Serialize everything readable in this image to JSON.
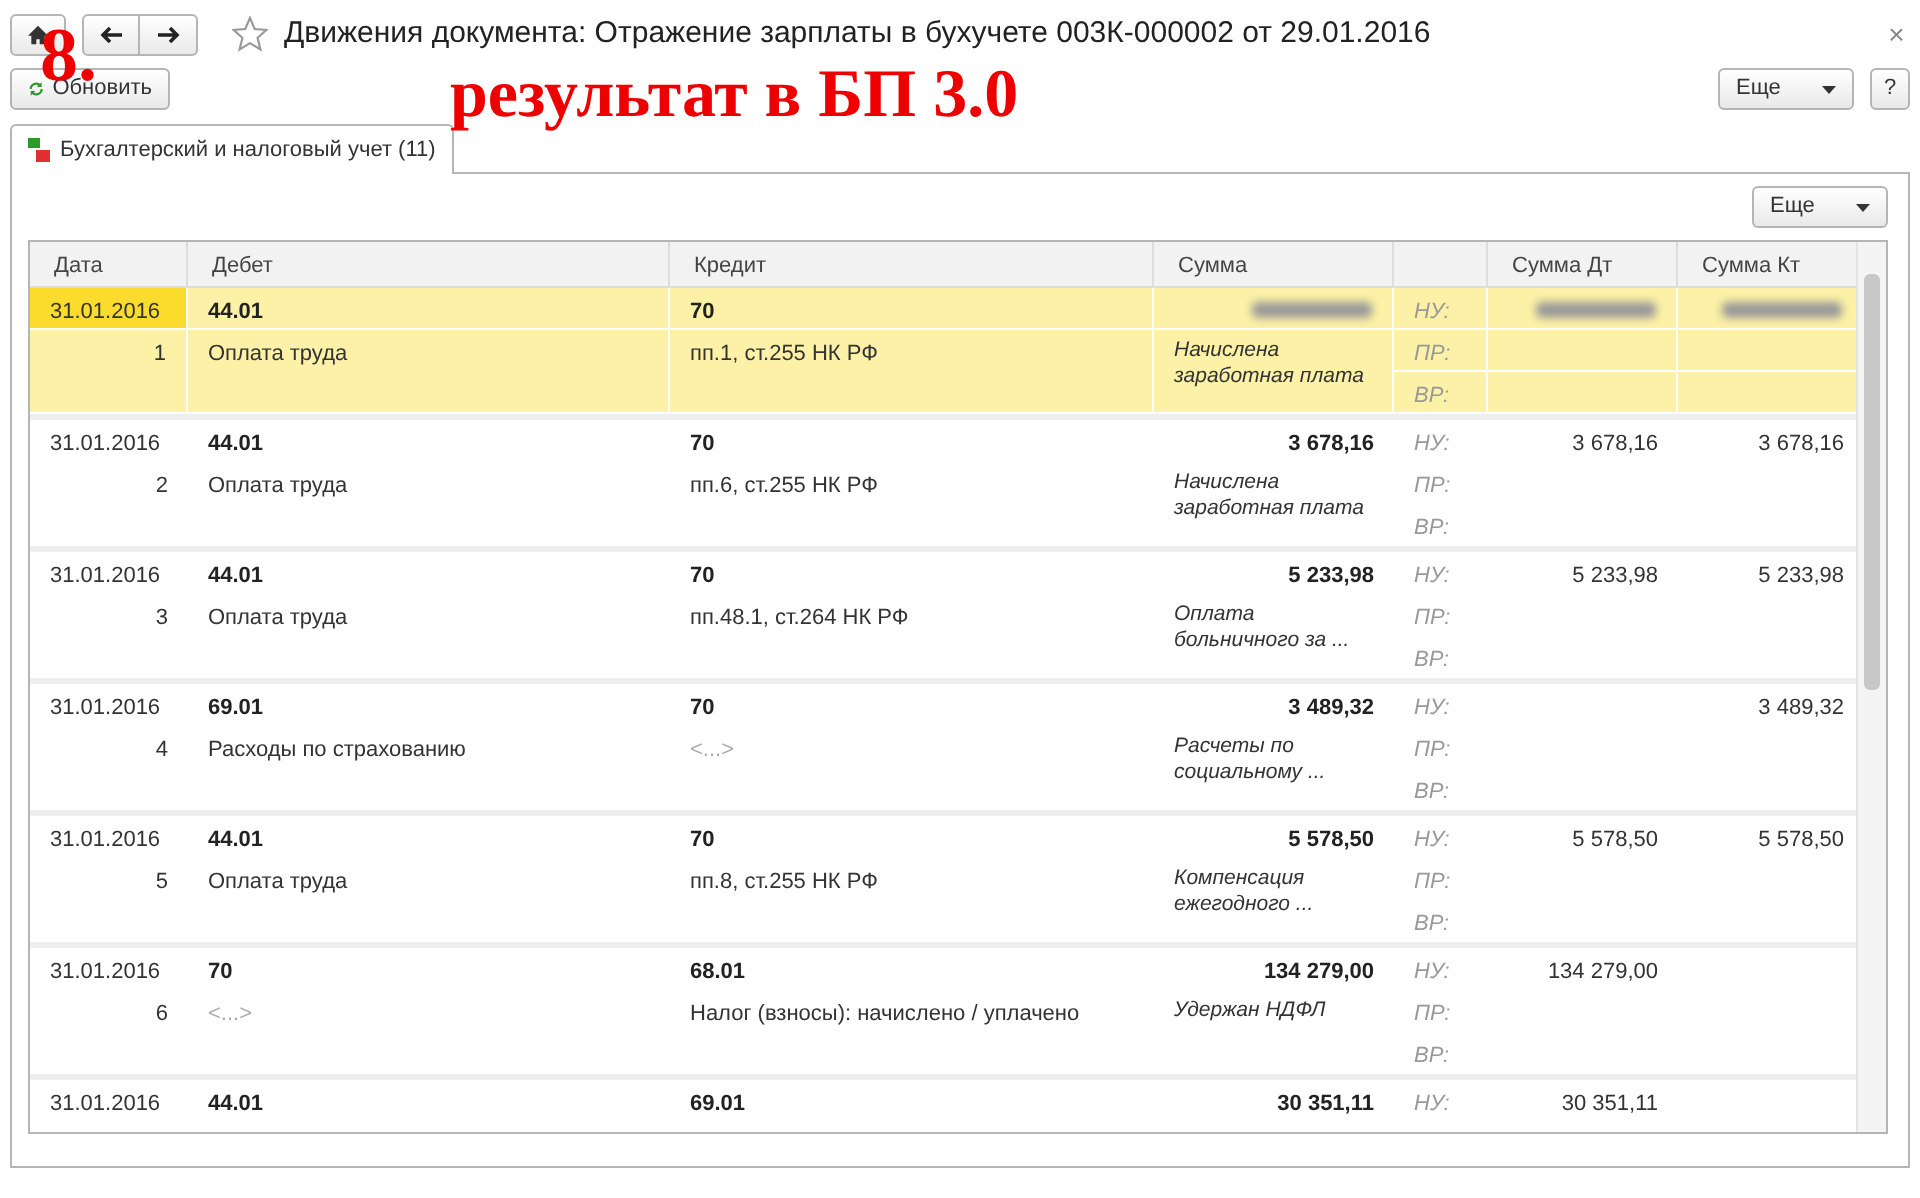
{
  "window": {
    "title": "Движения документа: Отражение зарплаты в бухучете 003К-000002 от 29.01.2016",
    "favorite": false,
    "close": "×"
  },
  "annotation": {
    "number": "8.",
    "text": "результат в БП 3.0"
  },
  "toolbar": {
    "refresh": "Обновить",
    "more": "Еще",
    "help": "?"
  },
  "tabs": [
    {
      "label": "Бухгалтерский и налоговый учет (11)",
      "selected": true
    }
  ],
  "table_toolbar": {
    "more": "Еще"
  },
  "table": {
    "columns": [
      "Дата",
      "Дебет",
      "Кредит",
      "Сумма",
      "Сумма Дт",
      "Сумма Кт"
    ],
    "records": [
      {
        "selected": true,
        "obscured": true,
        "date": "31.01.2016",
        "number": "1",
        "debit": "44.01",
        "debit_note": {
          "text": "Оплата труда",
          "empty": false
        },
        "credit": "70",
        "credit_note": {
          "text": "пп.1, ст.255 НК РФ",
          "empty": false
        },
        "content": "Начислена заработная плата",
        "labels": [
          "НУ:",
          "ПР:",
          "ВР:"
        ]
      },
      {
        "selected": false,
        "date": "31.01.2016",
        "number": "2",
        "debit": "44.01",
        "debit_note": {
          "text": "Оплата труда",
          "empty": false
        },
        "credit": "70",
        "credit_note": {
          "text": "пп.6, ст.255 НК РФ",
          "empty": false
        },
        "amount": "3 678,16",
        "content": "Начислена заработная плата",
        "labels": [
          "НУ:",
          "ПР:",
          "ВР:"
        ],
        "sum_dt": "3 678,16",
        "sum_kt": "3 678,16"
      },
      {
        "selected": false,
        "date": "31.01.2016",
        "number": "3",
        "debit": "44.01",
        "debit_note": {
          "text": "Оплата труда",
          "empty": false
        },
        "credit": "70",
        "credit_note": {
          "text": "пп.48.1, ст.264 НК РФ",
          "empty": false
        },
        "amount": "5 233,98",
        "content": "Оплата больничного за ...",
        "labels": [
          "НУ:",
          "ПР:",
          "ВР:"
        ],
        "sum_dt": "5 233,98",
        "sum_kt": "5 233,98"
      },
      {
        "selected": false,
        "date": "31.01.2016",
        "number": "4",
        "debit": "69.01",
        "debit_note": {
          "text": "Расходы по страхованию",
          "empty": false
        },
        "credit": "70",
        "credit_note": {
          "text": "<...>",
          "empty": true
        },
        "amount": "3 489,32",
        "content": "Расчеты по социальному ...",
        "labels": [
          "НУ:",
          "ПР:",
          "ВР:"
        ],
        "sum_kt": "3 489,32"
      },
      {
        "selected": false,
        "date": "31.01.2016",
        "number": "5",
        "debit": "44.01",
        "debit_note": {
          "text": "Оплата труда",
          "empty": false
        },
        "credit": "70",
        "credit_note": {
          "text": "пп.8, ст.255 НК РФ",
          "empty": false
        },
        "amount": "5 578,50",
        "content": "Компенсация ежегодного ...",
        "labels": [
          "НУ:",
          "ПР:",
          "ВР:"
        ],
        "sum_dt": "5 578,50",
        "sum_kt": "5 578,50"
      },
      {
        "selected": false,
        "date": "31.01.2016",
        "number": "6",
        "debit": "70",
        "debit_note": {
          "text": "<...>",
          "empty": true
        },
        "credit": "68.01",
        "credit_note": {
          "text": "Налог (взносы): начислено / уплачено",
          "empty": false
        },
        "amount": "134 279,00",
        "content": "Удержан НДФЛ",
        "labels": [
          "НУ:",
          "ПР:",
          "ВР:"
        ],
        "sum_dt": "134 279,00"
      },
      {
        "selected": false,
        "date": "31.01.2016",
        "debit": "44.01",
        "credit": "69.01",
        "amount": "30 351,11",
        "labels": [
          "НУ:"
        ],
        "sum_dt": "30 351,11"
      }
    ]
  }
}
